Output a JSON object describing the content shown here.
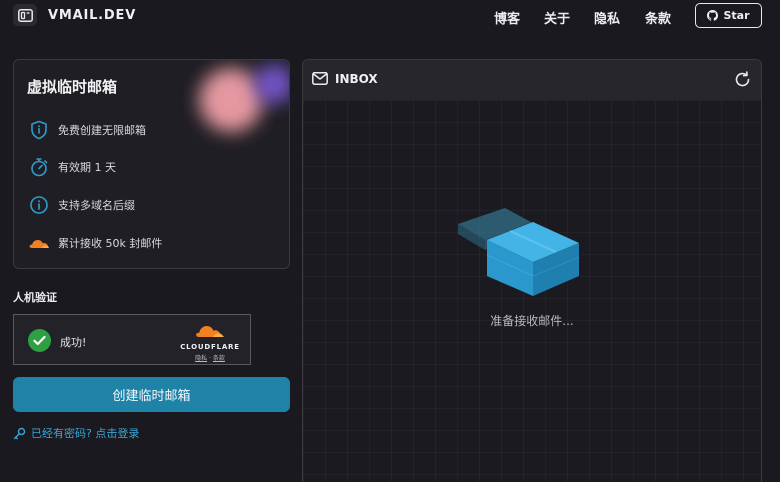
{
  "header": {
    "logo_text": "VMAIL.DEV",
    "nav": [
      "博客",
      "关于",
      "隐私",
      "条款"
    ],
    "star_label": "Star"
  },
  "features": {
    "title": "虚拟临时邮箱",
    "items": [
      {
        "icon": "shield-icon",
        "label": "免费创建无限邮箱"
      },
      {
        "icon": "stopwatch-icon",
        "label": "有效期 1 天"
      },
      {
        "icon": "info-icon",
        "label": "支持多域名后缀"
      },
      {
        "icon": "cloudflare-icon",
        "label": "累计接收 50k 封邮件"
      }
    ]
  },
  "captcha": {
    "label": "人机验证",
    "status": "成功!",
    "provider": "CLOUDFLARE",
    "link_privacy": "隐私",
    "link_sep": "·",
    "link_terms": "条款"
  },
  "create_button": "创建临时邮箱",
  "login_link": "已经有密码? 点击登录",
  "inbox": {
    "title": "INBOX",
    "empty_text": "准备接收邮件..."
  },
  "colors": {
    "accent": "#1f83a8",
    "link": "#39a6d6",
    "success": "#2ea043",
    "cloudflare": "#f38020"
  }
}
